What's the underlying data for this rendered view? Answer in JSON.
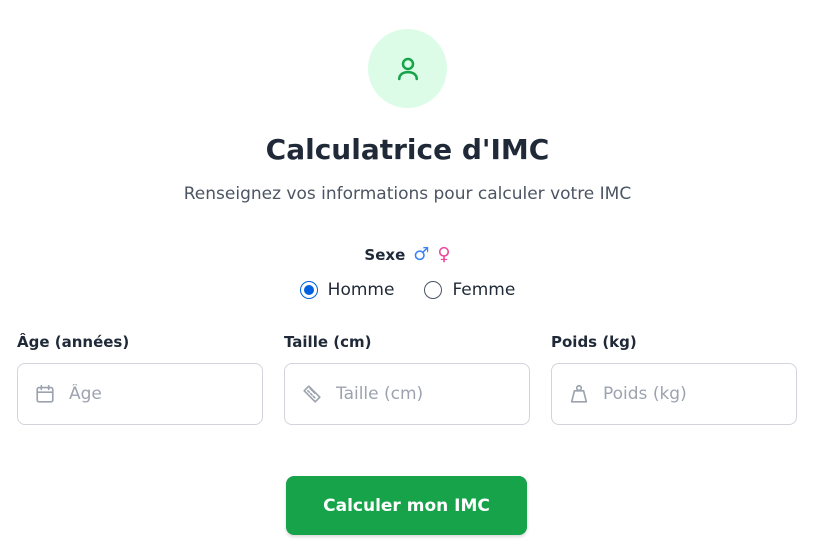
{
  "colors": {
    "accent": "#16a34a",
    "accent_light": "#dcfce7",
    "radio_selected": "#0060df",
    "male_symbol": "#3b82f6",
    "female_symbol": "#ec4899"
  },
  "header": {
    "icon": "user-icon",
    "title": "Calculatrice d'IMC",
    "subtitle": "Renseignez vos informations pour calculer votre IMC"
  },
  "sex": {
    "label": "Sexe",
    "male_symbol": "♂",
    "female_symbol": "♀",
    "options": [
      {
        "label": "Homme",
        "selected": true
      },
      {
        "label": "Femme",
        "selected": false
      }
    ]
  },
  "fields": [
    {
      "label": "Âge (années)",
      "placeholder": "Âge",
      "value": "",
      "icon": "calendar-icon"
    },
    {
      "label": "Taille (cm)",
      "placeholder": "Taille (cm)",
      "value": "",
      "icon": "ruler-icon"
    },
    {
      "label": "Poids (kg)",
      "placeholder": "Poids (kg)",
      "value": "",
      "icon": "weight-icon"
    }
  ],
  "submit": {
    "label": "Calculer mon IMC"
  }
}
